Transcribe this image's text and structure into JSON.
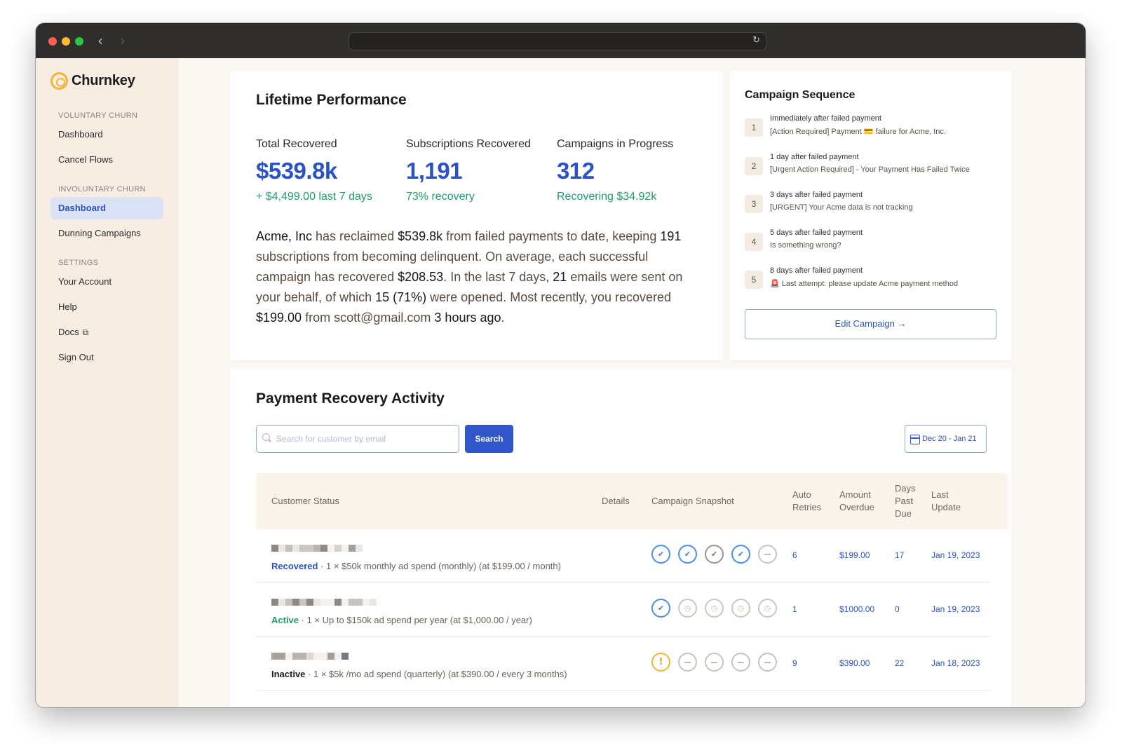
{
  "brand": {
    "name": "Churnkey",
    "accent": "#2c53c4",
    "green": "#1f9d6a",
    "logo_color": "#f0b53a"
  },
  "sidebar": {
    "sections": [
      {
        "label": "VOLUNTARY CHURN",
        "items": [
          {
            "label": "Dashboard"
          },
          {
            "label": "Cancel Flows"
          }
        ]
      },
      {
        "label": "INVOLUNTARY CHURN",
        "items": [
          {
            "label": "Dashboard",
            "active": true
          },
          {
            "label": "Dunning Campaigns"
          }
        ]
      },
      {
        "label": "SETTINGS",
        "items": [
          {
            "label": "Your Account"
          },
          {
            "label": "Help"
          },
          {
            "label": "Docs",
            "icon": "external-link-icon"
          },
          {
            "label": "Sign Out"
          }
        ]
      }
    ]
  },
  "performance": {
    "title": "Lifetime Performance",
    "metrics": [
      {
        "label": "Total Recovered",
        "value": "$539.8k",
        "sub": "+ $4,499.00 last 7 days"
      },
      {
        "label": "Subscriptions Recovered",
        "value": "1,191",
        "sub": "73% recovery"
      },
      {
        "label": "Campaigns in Progress",
        "value": "312",
        "sub": "Recovering $34.92k"
      }
    ],
    "summary": {
      "company": "Acme, Inc",
      "t1": " has reclaimed ",
      "amount": "$539.8k",
      "t2": " from failed payments to date, keeping ",
      "subs": "191",
      "t3": " subscriptions from becoming delinquent. On average, each successful campaign has recovered ",
      "avg": "$208.53",
      "t4": ". In the last 7 days, ",
      "emails": "21",
      "t5": " emails were sent on your behalf, of which ",
      "opened": "15 (71%)",
      "t6": " were opened. Most recently, you recovered ",
      "recent": "$199.00",
      "t7": " from ",
      "email": "scott@gmail.com",
      "t8": " ",
      "ago": "3 hours ago",
      "t9": "."
    }
  },
  "campaign": {
    "title": "Campaign Sequence",
    "steps": [
      {
        "num": "1",
        "when": "Immediately after failed payment",
        "subject": "[Action Required] Payment 💳 failure for Acme, Inc."
      },
      {
        "num": "2",
        "when": "1 day after failed payment",
        "subject": "[Urgent Action Required] - Your Payment Has Failed Twice"
      },
      {
        "num": "3",
        "when": "3 days after failed payment",
        "subject": "[URGENT] Your Acme data is not tracking"
      },
      {
        "num": "4",
        "when": "5 days after failed payment",
        "subject": "Is something wrong?"
      },
      {
        "num": "5",
        "when": "8 days after failed payment",
        "subject": "🚨 Last attempt: please update Acme payment method"
      }
    ],
    "edit_label": "Edit Campaign →"
  },
  "activity": {
    "title": "Payment Recovery Activity",
    "search_placeholder": "Search for customer by email",
    "search_label": "Search",
    "date_range": "Dec 20 - Jan 21",
    "columns": {
      "status": "Customer Status",
      "details": "Details",
      "snapshot": "Campaign Snapshot",
      "retries": "Auto Retries",
      "amount": "Amount Overdue",
      "days": "Days Past Due",
      "update": "Last Update"
    },
    "rows": [
      {
        "status": "Recovered",
        "plan": " · 1 × $50k monthly ad spend (monthly) (at $199.00 / month)",
        "snapshot": [
          "check-blue",
          "check-blue",
          "check-grey",
          "check-blue",
          "skipped"
        ],
        "retries": "6",
        "amount": "$199.00",
        "days": "17",
        "update": "Jan 19, 2023"
      },
      {
        "status": "Active",
        "plan": " · 1 × Up to $150k ad spend per year (at $1,000.00 / year)",
        "snapshot": [
          "check-blue",
          "clock",
          "clock",
          "clock",
          "clock"
        ],
        "retries": "1",
        "amount": "$1000.00",
        "days": "0",
        "update": "Jan 19, 2023"
      },
      {
        "status": "Inactive",
        "plan": " · 1 × $5k /mo ad spend (quarterly) (at $390.00 / every 3 months)",
        "snapshot": [
          "warning",
          "skipped",
          "skipped",
          "skipped",
          "skipped"
        ],
        "retries": "9",
        "amount": "$390.00",
        "days": "22",
        "update": "Jan 18, 2023"
      }
    ]
  }
}
